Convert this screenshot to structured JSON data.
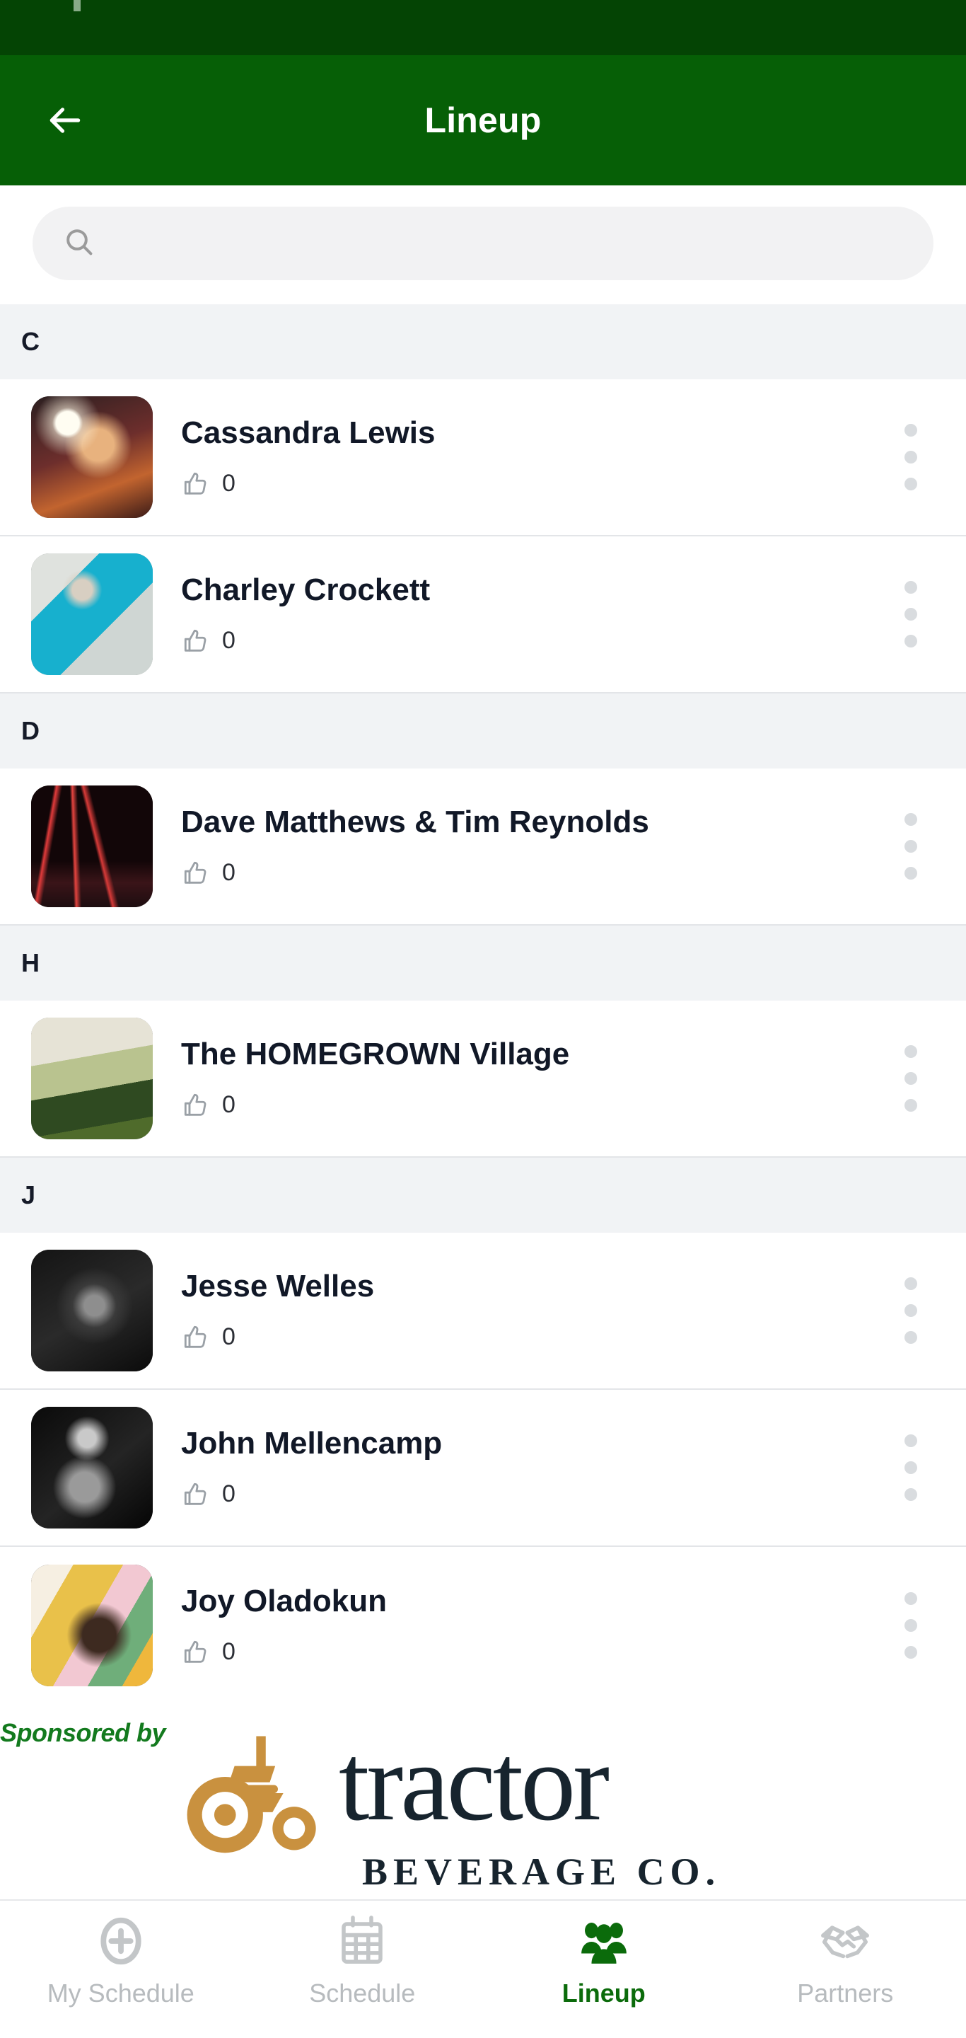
{
  "theme": {
    "status_bar_color": "#044404",
    "app_bar_color": "#065f06",
    "accent_green": "#0b6b0b",
    "sponsored_text_color": "#137a1e",
    "section_header_bg": "#f1f3f5",
    "search_bg": "#f2f2f3",
    "kebab_dot_color": "#d9dcdf",
    "tractor_orange": "#c9913f",
    "tractor_ink": "#17242e"
  },
  "app_bar": {
    "back_icon": "arrow-left-icon",
    "title": "Lineup"
  },
  "search": {
    "icon": "search-icon",
    "value": "",
    "placeholder": ""
  },
  "sections": [
    {
      "letter": "C",
      "items": [
        {
          "name": "Cassandra Lewis",
          "likes": "0",
          "like_icon": "thumbs-up-icon",
          "menu_icon": "more-vertical-icon",
          "thumb_class": "th-cassandra"
        },
        {
          "name": "Charley Crockett",
          "likes": "0",
          "like_icon": "thumbs-up-icon",
          "menu_icon": "more-vertical-icon",
          "thumb_class": "th-charley"
        }
      ]
    },
    {
      "letter": "D",
      "items": [
        {
          "name": "Dave Matthews & Tim Reynolds",
          "likes": "0",
          "like_icon": "thumbs-up-icon",
          "menu_icon": "more-vertical-icon",
          "thumb_class": "th-dave"
        }
      ]
    },
    {
      "letter": "H",
      "items": [
        {
          "name": "The HOMEGROWN Village",
          "likes": "0",
          "like_icon": "thumbs-up-icon",
          "menu_icon": "more-vertical-icon",
          "thumb_class": "th-homegrown"
        }
      ]
    },
    {
      "letter": "J",
      "items": [
        {
          "name": "Jesse Welles",
          "likes": "0",
          "like_icon": "thumbs-up-icon",
          "menu_icon": "more-vertical-icon",
          "thumb_class": "th-jesse"
        },
        {
          "name": "John Mellencamp",
          "likes": "0",
          "like_icon": "thumbs-up-icon",
          "menu_icon": "more-vertical-icon",
          "thumb_class": "th-john"
        },
        {
          "name": "Joy Oladokun",
          "likes": "0",
          "like_icon": "thumbs-up-icon",
          "menu_icon": "more-vertical-icon",
          "thumb_class": "th-joy"
        }
      ]
    }
  ],
  "sponsor": {
    "label": "Sponsored by",
    "brand_name": "tractor",
    "brand_tagline": "BEVERAGE CO.",
    "logo_icon": "tractor-icon"
  },
  "tabbar": {
    "tabs": [
      {
        "label": "My Schedule",
        "icon": "plus-circle-icon",
        "active": false
      },
      {
        "label": "Schedule",
        "icon": "calendar-icon",
        "active": false
      },
      {
        "label": "Lineup",
        "icon": "people-group-icon",
        "active": true
      },
      {
        "label": "Partners",
        "icon": "handshake-icon",
        "active": false
      }
    ]
  }
}
